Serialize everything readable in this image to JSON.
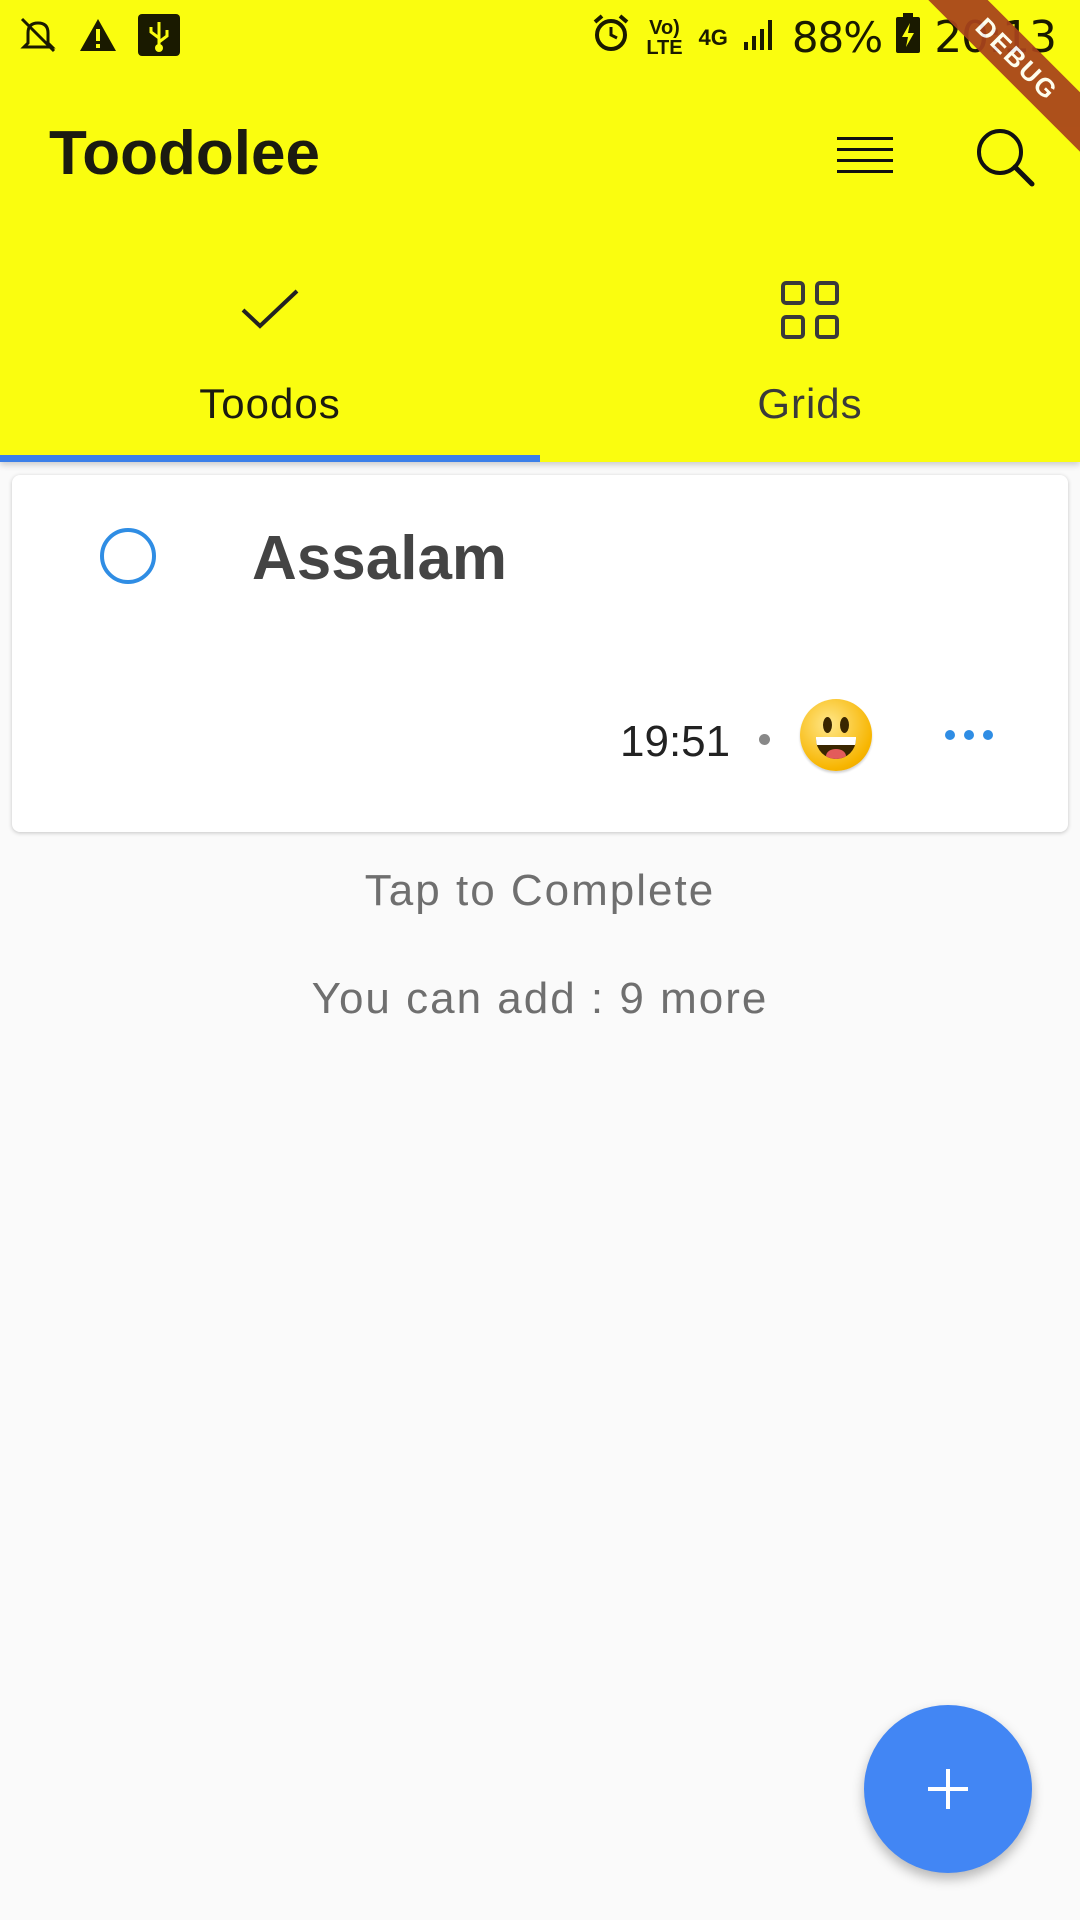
{
  "status_bar": {
    "left_icons": [
      "notifications-off-icon",
      "warning-icon",
      "usb-icon"
    ],
    "right_icons": [
      "alarm-icon",
      "volte-icon",
      "4g-icon",
      "signal-icon",
      "battery-charging-icon"
    ],
    "volte_label": "Vo) LTE",
    "network_label": "4G",
    "battery": "88%",
    "time": "20:13"
  },
  "debug_banner": "DEBUG",
  "app_bar": {
    "title": "Toodolee",
    "actions": [
      "list-view-icon",
      "search-icon"
    ]
  },
  "tabs": [
    {
      "label": "Toodos",
      "icon": "check-icon",
      "selected": true
    },
    {
      "label": "Grids",
      "icon": "grid-icon",
      "selected": false
    }
  ],
  "todos": [
    {
      "title": "Assalam",
      "time": "19:51",
      "emoji": "grinning-face",
      "completed": false
    }
  ],
  "hints": {
    "tap": "Tap to Complete",
    "remaining": "You can add : 9 more"
  },
  "fab": {
    "icon": "plus-icon"
  },
  "colors": {
    "app_bar": "#fafd0f",
    "accent": "#4286f4",
    "indicator": "#3b7fe8",
    "background": "#fafafa"
  }
}
